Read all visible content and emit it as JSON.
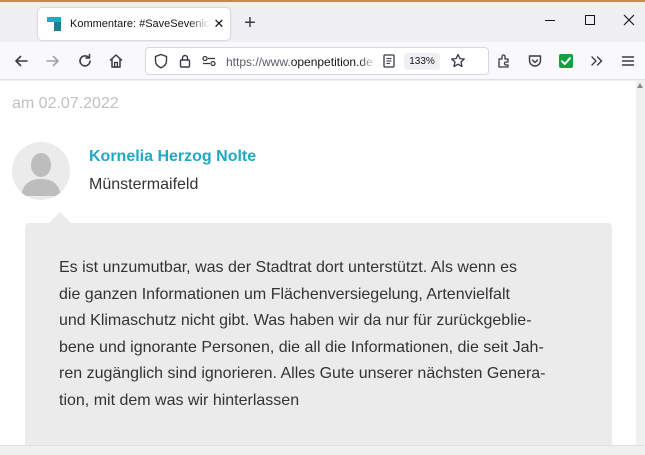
{
  "browser": {
    "tab": {
      "title": "Kommentare: #SaveSevenich - Einspruch gegen den Bebauungsplan",
      "favicon": "openpetition-icon"
    },
    "url_prefix": "https://www.",
    "url_domain": "openpetition.de",
    "zoom": "133%",
    "icons": [
      "back-icon",
      "forward-icon",
      "reload-icon",
      "home-icon",
      "shield-icon",
      "lock-icon",
      "permissions-icon",
      "reader-view-icon",
      "bookmark-star-icon",
      "extensions-icon",
      "pocket-icon",
      "green-check-extension-icon",
      "overflow-chevrons-icon",
      "menu-icon"
    ]
  },
  "comment": {
    "date": "am 02.07.2022",
    "author": "Kornelia Herzog Nolte",
    "location": "Münstermaifeld",
    "lines": [
      "Es ist unzumutbar, was der Stadtrat dort unterstützt. Als wenn es",
      "die ganzen Informationen um Flächenversiegelung, Artenvielfalt",
      "und Klimaschutz nicht gibt. Was haben wir da nur für zurückgeblie-",
      "bene und ignorante Personen, die all die Informationen, die seit Jah-",
      "ren zugänglich sind ignorieren. Alles Gute unserer nächsten Genera-",
      "tion, mit dem was wir hinterlassen"
    ]
  },
  "colors": {
    "author_name": "#1fa9c2",
    "bubble_bg": "#ebebeb",
    "date_text": "#c0c0c4"
  }
}
